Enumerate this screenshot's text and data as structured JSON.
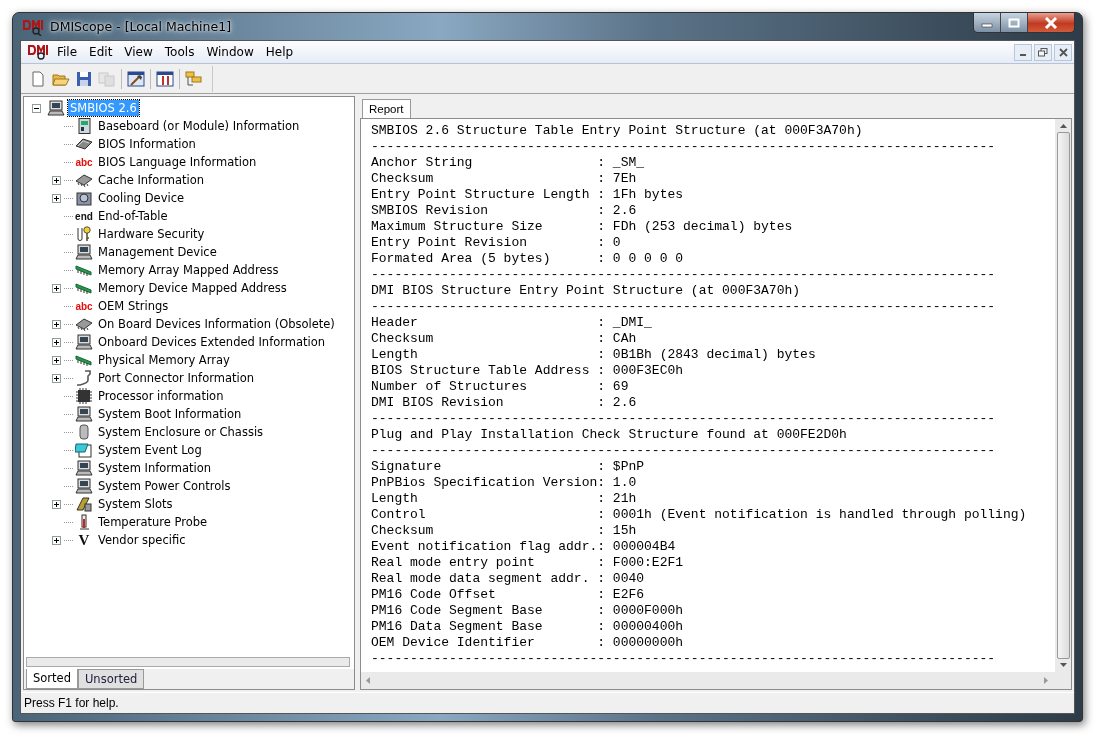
{
  "window": {
    "title": "DMIScope - [Local Machine1]"
  },
  "menu": [
    "File",
    "Edit",
    "View",
    "Tools",
    "Window",
    "Help"
  ],
  "toolbar": [
    {
      "kind": "new",
      "disabled": false
    },
    {
      "kind": "open",
      "disabled": false
    },
    {
      "kind": "save",
      "disabled": false
    },
    {
      "kind": "copy",
      "disabled": true
    },
    {
      "kind": "sep"
    },
    {
      "kind": "hammer",
      "disabled": false
    },
    {
      "kind": "sep"
    },
    {
      "kind": "columns",
      "disabled": false
    },
    {
      "kind": "sep"
    },
    {
      "kind": "folders",
      "disabled": false
    }
  ],
  "tree": {
    "label": "SMBIOS 2.6",
    "expanded": true,
    "selected": true,
    "children": [
      {
        "label": "Baseboard (or Module) Information",
        "kind": "board",
        "expandable": false,
        "selected": false
      },
      {
        "label": "BIOS Information",
        "kind": "chip",
        "expandable": false,
        "selected": false
      },
      {
        "label": "BIOS Language Information",
        "kind": "text",
        "icon_text": "abc",
        "expandable": false,
        "selected": false
      },
      {
        "label": "Cache Information",
        "kind": "module",
        "expandable": true,
        "selected": false
      },
      {
        "label": "Cooling Device",
        "kind": "fan",
        "expandable": true,
        "selected": false
      },
      {
        "label": "End-of-Table",
        "kind": "word",
        "icon_text": "end",
        "expandable": false,
        "selected": false
      },
      {
        "label": "Hardware Security",
        "kind": "key",
        "expandable": false,
        "selected": false
      },
      {
        "label": "Management Device",
        "kind": "computer",
        "expandable": false,
        "selected": false
      },
      {
        "label": "Memory Array Mapped Address",
        "kind": "ram",
        "expandable": false,
        "selected": false
      },
      {
        "label": "Memory Device Mapped Address",
        "kind": "ram",
        "expandable": true,
        "selected": false
      },
      {
        "label": "OEM Strings",
        "kind": "text",
        "icon_text": "abc",
        "expandable": false,
        "selected": false
      },
      {
        "label": "On Board Devices Information (Obsolete)",
        "kind": "module",
        "expandable": true,
        "selected": false
      },
      {
        "label": "Onboard Devices Extended Information",
        "kind": "computer",
        "expandable": true,
        "selected": false
      },
      {
        "label": "Physical Memory Array",
        "kind": "ram",
        "expandable": true,
        "selected": false
      },
      {
        "label": "Port Connector Information",
        "kind": "plug",
        "expandable": true,
        "selected": false
      },
      {
        "label": "Processor information",
        "kind": "cpu",
        "expandable": false,
        "selected": false
      },
      {
        "label": "System Boot Information",
        "kind": "computer",
        "expandable": false,
        "selected": false
      },
      {
        "label": "System Enclosure or Chassis",
        "kind": "tower",
        "expandable": false,
        "selected": false
      },
      {
        "label": "System Event Log",
        "kind": "log",
        "expandable": false,
        "selected": false
      },
      {
        "label": "System Information",
        "kind": "computer",
        "expandable": false,
        "selected": false
      },
      {
        "label": "System Power Controls",
        "kind": "computer",
        "expandable": false,
        "selected": false
      },
      {
        "label": "System Slots",
        "kind": "slot",
        "expandable": true,
        "selected": false
      },
      {
        "label": "Temperature Probe",
        "kind": "thermo",
        "expandable": false,
        "selected": false
      },
      {
        "label": "Vendor specific",
        "kind": "letter",
        "icon_text": "V",
        "expandable": true,
        "selected": false
      }
    ]
  },
  "left_tabs": [
    {
      "label": "Sorted",
      "selected": true
    },
    {
      "label": "Unsorted",
      "selected": false
    }
  ],
  "report_tabs": [
    {
      "label": "Report",
      "selected": true
    }
  ],
  "report": [
    {
      "kind": "heading",
      "text": "SMBIOS 2.6 Structure Table Entry Point Structure (at 000F3A70h)"
    },
    {
      "kind": "rule",
      "text": "--------------------------------------------------------------------------------"
    },
    {
      "kind": "field",
      "label": "Anchor String",
      "sep": ":",
      "value": "_SM_"
    },
    {
      "kind": "field",
      "label": "Checksum",
      "sep": ":",
      "value": "7Eh"
    },
    {
      "kind": "field",
      "label": "Entry Point Structure Length",
      "sep": ":",
      "value": "1Fh bytes"
    },
    {
      "kind": "field",
      "label": "SMBIOS Revision",
      "sep": ":",
      "value": "2.6"
    },
    {
      "kind": "field",
      "label": "Maximum Structure Size",
      "sep": ":",
      "value": "FDh (253 decimal) bytes"
    },
    {
      "kind": "field",
      "label": "Entry Point Revision",
      "sep": ":",
      "value": "0"
    },
    {
      "kind": "field",
      "label": "Formated Area (5 bytes)",
      "sep": ":",
      "value": "0 0 0 0 0"
    },
    {
      "kind": "rule",
      "text": "--------------------------------------------------------------------------------"
    },
    {
      "kind": "heading",
      "text": "DMI BIOS Structure Entry Point Structure (at 000F3A70h)"
    },
    {
      "kind": "rule",
      "text": "--------------------------------------------------------------------------------"
    },
    {
      "kind": "field",
      "label": "Header",
      "sep": ":",
      "value": "_DMI_"
    },
    {
      "kind": "field",
      "label": "Checksum",
      "sep": ":",
      "value": "CAh"
    },
    {
      "kind": "field",
      "label": "Length",
      "sep": ":",
      "value": "0B1Bh (2843 decimal) bytes"
    },
    {
      "kind": "field",
      "label": "BIOS Structure Table Address",
      "sep": ":",
      "value": "000F3EC0h"
    },
    {
      "kind": "field",
      "label": "Number of Structures",
      "sep": ":",
      "value": "69"
    },
    {
      "kind": "field",
      "label": "DMI BIOS Revision",
      "sep": ":",
      "value": "2.6"
    },
    {
      "kind": "rule",
      "text": "--------------------------------------------------------------------------------"
    },
    {
      "kind": "heading",
      "text": "Plug and Play Installation Check Structure found at 000FE2D0h"
    },
    {
      "kind": "rule",
      "text": "--------------------------------------------------------------------------------"
    },
    {
      "kind": "field",
      "label": "Signature",
      "sep": ":",
      "value": "$PnP"
    },
    {
      "kind": "field",
      "label": "PnPBios Specification Version",
      "sep": ":",
      "value": "1.0"
    },
    {
      "kind": "field",
      "label": "Length",
      "sep": ":",
      "value": "21h"
    },
    {
      "kind": "field",
      "label": "Control",
      "sep": ":",
      "value": "0001h (Event notification is handled through polling)"
    },
    {
      "kind": "field",
      "label": "Checksum",
      "sep": ":",
      "value": "15h"
    },
    {
      "kind": "field",
      "label": "Event notification flag addr.",
      "sep": ":",
      "value": "000004B4"
    },
    {
      "kind": "field",
      "label": "Real mode entry point",
      "sep": ":",
      "value": "F000:E2F1"
    },
    {
      "kind": "field",
      "label": "Real mode data segment addr.",
      "sep": ":",
      "value": "0040"
    },
    {
      "kind": "field",
      "label": "PM16 Code Offset",
      "sep": ":",
      "value": "E2F6"
    },
    {
      "kind": "field",
      "label": "PM16 Code Segment Base",
      "sep": ":",
      "value": "0000F000h"
    },
    {
      "kind": "field",
      "label": "PM16 Data Segment Base",
      "sep": ":",
      "value": "00000400h"
    },
    {
      "kind": "field",
      "label": "OEM Device Identifier",
      "sep": ":",
      "value": "00000000h"
    },
    {
      "kind": "rule",
      "text": "--------------------------------------------------------------------------------"
    }
  ],
  "status_bar": "Press F1 for help."
}
